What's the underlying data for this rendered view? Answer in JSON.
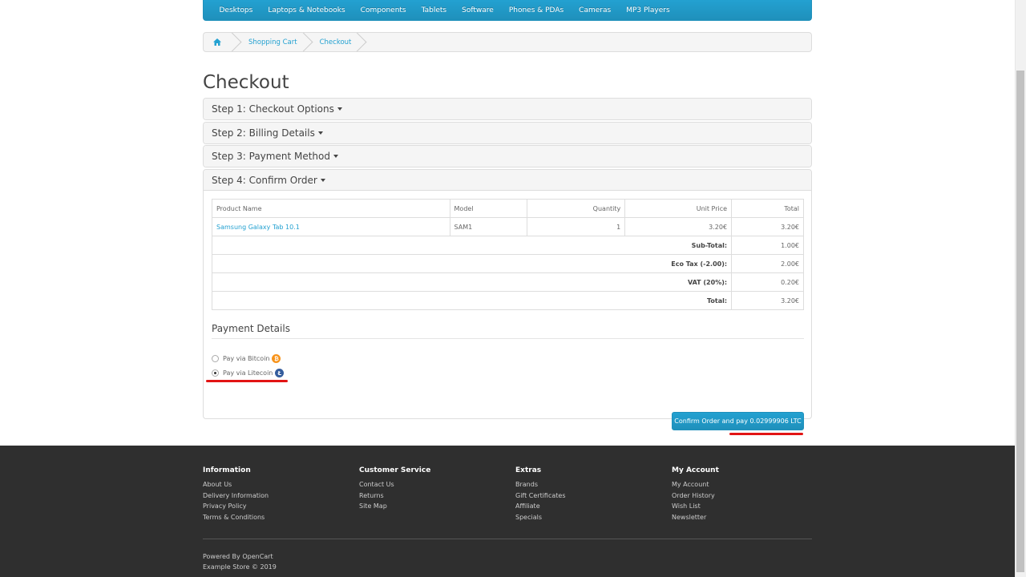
{
  "menu": {
    "items": [
      "Desktops",
      "Laptops & Notebooks",
      "Components",
      "Tablets",
      "Software",
      "Phones & PDAs",
      "Cameras",
      "MP3 Players"
    ]
  },
  "breadcrumb": {
    "home_icon": "home-icon",
    "items": [
      "Shopping Cart",
      "Checkout"
    ]
  },
  "page_title": "Checkout",
  "steps": [
    "Step 1: Checkout Options",
    "Step 2: Billing Details",
    "Step 3: Payment Method",
    "Step 4: Confirm Order"
  ],
  "order_table": {
    "headers": [
      "Product Name",
      "Model",
      "Quantity",
      "Unit Price",
      "Total"
    ],
    "rows": [
      {
        "product": "Samsung Galaxy Tab 10.1",
        "model": "SAM1",
        "quantity": "1",
        "unit_price": "3.20€",
        "total": "3.20€"
      }
    ],
    "totals": [
      {
        "label": "Sub-Total:",
        "value": "1.00€"
      },
      {
        "label": "Eco Tax (-2.00):",
        "value": "2.00€"
      },
      {
        "label": "VAT (20%):",
        "value": "0.20€"
      },
      {
        "label": "Total:",
        "value": "3.20€"
      }
    ]
  },
  "payment": {
    "title": "Payment Details",
    "options": [
      {
        "label": "Pay via Bitcoin",
        "icon": "bitcoin-icon",
        "checked": false
      },
      {
        "label": "Pay via Litecoin",
        "icon": "litecoin-icon",
        "checked": true
      }
    ],
    "confirm_button": "Confirm Order and pay 0.02999906 LTC"
  },
  "footer": {
    "columns": [
      {
        "title": "Information",
        "links": [
          "About Us",
          "Delivery Information",
          "Privacy Policy",
          "Terms & Conditions"
        ]
      },
      {
        "title": "Customer Service",
        "links": [
          "Contact Us",
          "Returns",
          "Site Map"
        ]
      },
      {
        "title": "Extras",
        "links": [
          "Brands",
          "Gift Certificates",
          "Affiliate",
          "Specials"
        ]
      },
      {
        "title": "My Account",
        "links": [
          "My Account",
          "Order History",
          "Wish List",
          "Newsletter"
        ]
      }
    ],
    "powered_prefix": "Powered By",
    "powered_link": "OpenCart",
    "copyright": "Example Store © 2019"
  },
  "colors": {
    "accent": "#23a1d1",
    "footer_bg": "#2f2f2f",
    "highlight_red": "#e21414",
    "bitcoin": "#f7931a",
    "litecoin": "#345d9d"
  }
}
